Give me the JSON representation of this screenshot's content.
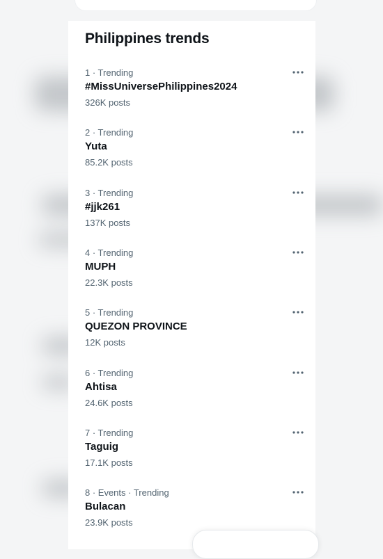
{
  "panel": {
    "title": "Philippines trends"
  },
  "trends": [
    {
      "meta": "1 · Trending",
      "name": "#MissUniversePhilippines2024",
      "count": "326K posts"
    },
    {
      "meta": "2 · Trending",
      "name": "Yuta",
      "count": "85.2K posts"
    },
    {
      "meta": "3 · Trending",
      "name": "#jjk261",
      "count": "137K posts"
    },
    {
      "meta": "4 · Trending",
      "name": "MUPH",
      "count": "22.3K posts"
    },
    {
      "meta": "5 · Trending",
      "name": "QUEZON PROVINCE",
      "count": "12K posts"
    },
    {
      "meta": "6 · Trending",
      "name": "Ahtisa",
      "count": "24.6K posts"
    },
    {
      "meta": "7 · Trending",
      "name": "Taguig",
      "count": "17.1K posts"
    },
    {
      "meta": "8 · Events · Trending",
      "name": "Bulacan",
      "count": "23.9K posts"
    }
  ],
  "icons": {
    "more": "more-horizontal-icon"
  },
  "colors": {
    "text_primary": "#0f1419",
    "text_secondary": "#536471",
    "background": "#ffffff"
  }
}
